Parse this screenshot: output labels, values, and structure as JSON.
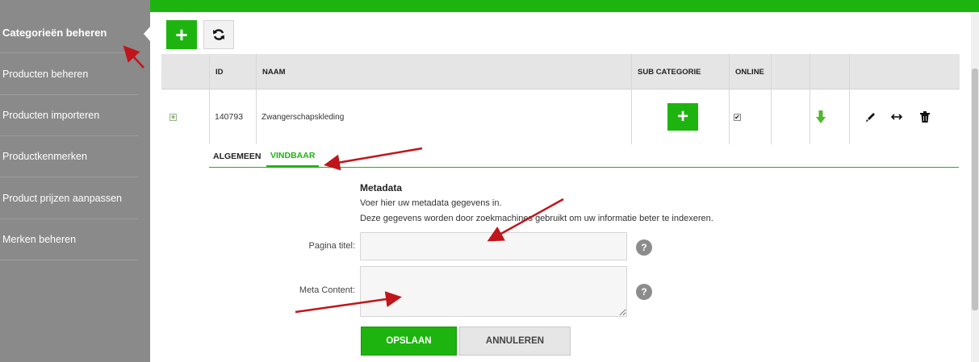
{
  "sidebar": {
    "items": [
      {
        "label": "Categorieën beheren",
        "active": true
      },
      {
        "label": "Producten beheren"
      },
      {
        "label": "Producten importeren"
      },
      {
        "label": "Productkenmerken"
      },
      {
        "label": "Product prijzen aanpassen"
      },
      {
        "label": "Merken beheren"
      }
    ]
  },
  "toolbar": {
    "add_icon": "plus-icon",
    "refresh_icon": "refresh-icon",
    "add_symbol": "+"
  },
  "table": {
    "columns": [
      "ID",
      "NAAM",
      "SUB CATEGORIE",
      "ONLINE"
    ],
    "row": {
      "expand_symbol": "+",
      "id": "140793",
      "naam": "Zwangerschapskleding",
      "sub_add_symbol": "+",
      "online_checked": true,
      "check_symbol": "✔"
    }
  },
  "tabs": [
    {
      "label": "ALGEMEEN"
    },
    {
      "label": "VINDBAAR",
      "active": true
    }
  ],
  "form": {
    "title": "Metadata",
    "desc1": "Voer hier uw metadata gegevens in.",
    "desc2": "Deze gegevens worden door zoekmachines gebruikt om uw informatie beter te indexeren.",
    "page_title_label": "Pagina titel:",
    "page_title_value": "",
    "meta_content_label": "Meta Content:",
    "meta_content_value": "",
    "help_symbol": "?",
    "save_label": "OPSLAAN",
    "cancel_label": "ANNULEREN"
  },
  "colors": {
    "accent": "#1eb40f",
    "sidebar": "#8a8a8a",
    "arrow": "#c0151b",
    "help": "#8c8c8c"
  }
}
